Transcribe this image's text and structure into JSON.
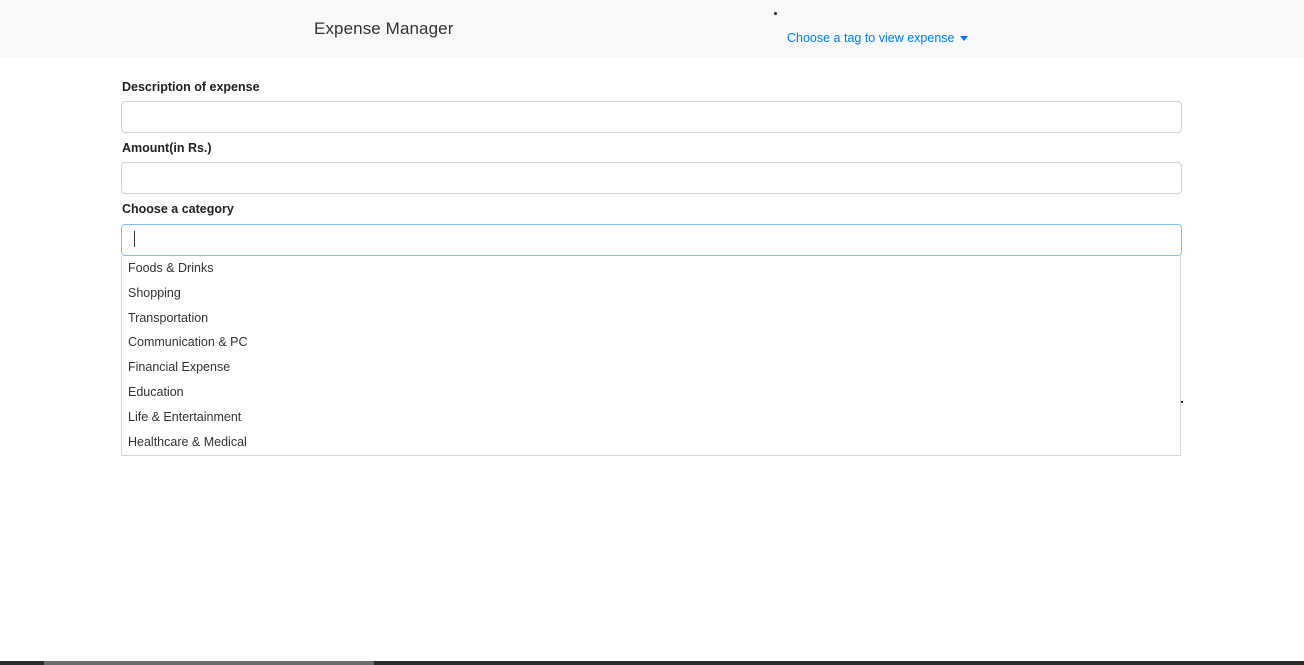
{
  "navbar": {
    "brand": "Expense Manager",
    "tag_dropdown_label": "Choose a tag to view expense",
    "tag_dropdown_icon": "caret-down-icon",
    "link_color": "#007bff"
  },
  "form": {
    "description": {
      "label": "Description of expense",
      "value": ""
    },
    "amount": {
      "label": "Amount(in Rs.)",
      "value": ""
    },
    "category": {
      "label": "Choose a category",
      "value": "",
      "options": [
        "Foods & Drinks",
        "Shopping",
        "Transportation",
        "Communication & PC",
        "Financial Expense",
        "Education",
        "Life & Entertainment",
        "Healthcare & Medical"
      ]
    }
  }
}
